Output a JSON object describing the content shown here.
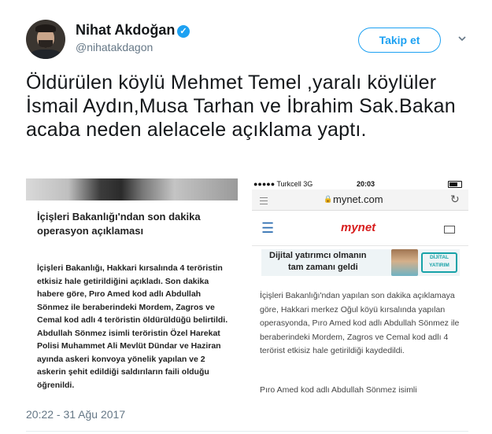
{
  "user": {
    "name": "Nihat Akdoğan",
    "handle": "@nihatakdagon",
    "verified_icon": "✓"
  },
  "follow_button": {
    "label": "Takip et"
  },
  "tweet": {
    "text": "Öldürülen köylü Mehmet Temel ,yaralı köylüler İsmail Aydın,Musa Tarhan ve İbrahim Sak.Bakan acaba neden alelacele açıklama yaptı.",
    "timestamp": "20:22 - 31 Ağu 2017"
  },
  "media_left": {
    "title": "İçişleri Bakanlığı'ndan son dakika operasyon açıklaması",
    "body": "İçişleri Bakanlığı, Hakkari kırsalında 4 teröristin etkisiz hale getirildiğini açıkladı. Son dakika habere göre, Pıro Amed kod adlı Abdullah Sönmez ile beraberindeki Mordem, Zagros ve Cemal kod adlı 4 teröristin öldürüldüğü belirtildi. Abdullah Sönmez isimli teröristin Özel Harekat Polisi Muhammet Ali Mevlüt Dündar ve Haziran ayında askeri konvoya yönelik yapılan ve 2 askerin şehit edildiği saldırıların faili olduğu öğrenildi."
  },
  "media_right": {
    "status_left": "●●●●● Turkcell 3G",
    "status_time": "20:03",
    "url": "mynet.com",
    "logo": "mynet",
    "ad_line1": "Dijital yatırımcı olmanın",
    "ad_line2": "tam zamanı geldi",
    "ad_badge": "DİJİTAL YATIRIM",
    "paragraph1": "İçişleri Bakanlığı'ndan yapılan son dakika açıklamaya göre, Hakkari merkez Oğul köyü kırsalında yapılan operasyonda, Pıro Amed kod adlı Abdullah Sönmez ile beraberindeki Mordem, Zagros ve Cemal kod adlı 4 terörist etkisiz hale getirildiği kaydedildi.",
    "paragraph2": "Pıro Amed kod adlı Abdullah Sönmez isimli"
  },
  "icons": {
    "caret": "chevron-down-icon",
    "verified": "verified-badge-icon",
    "lock": "lock-icon",
    "reload": "reload-icon",
    "menu": "hamburger-menu-icon",
    "mail": "mail-icon"
  },
  "colors": {
    "accent": "#1da1f2",
    "text": "#14171a",
    "muted": "#657786",
    "mynet_red": "#d81e1e"
  }
}
